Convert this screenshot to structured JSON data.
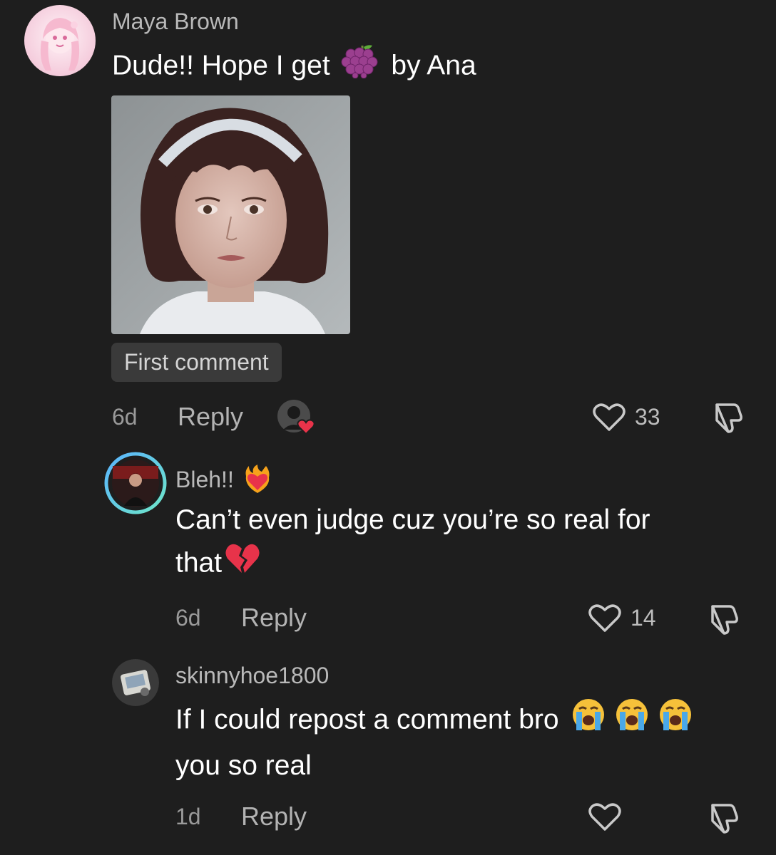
{
  "comments": [
    {
      "username": "Maya Brown",
      "text_before": "Dude!! Hope I get",
      "text_emoji": "grapes-emoji",
      "text_after": "by Ana",
      "tag": "First comment",
      "time": "6d",
      "reply_label": "Reply",
      "likes": "33",
      "liked_by_creator": true
    },
    {
      "username": "Bleh!!",
      "username_emoji": "heart-on-fire-emoji",
      "text_line1": "Can’t even judge cuz you’re so real for",
      "text_line2": "that",
      "text_emoji": "broken-heart-emoji",
      "time": "6d",
      "reply_label": "Reply",
      "likes": "14"
    },
    {
      "username": "skinnyhoe1800",
      "text_line1": "If I could repost a comment bro",
      "text_emojis": [
        "loudly-crying-emoji",
        "loudly-crying-emoji",
        "loudly-crying-emoji"
      ],
      "text_line2": "you so real",
      "time": "1d",
      "reply_label": "Reply",
      "likes": ""
    }
  ],
  "colors": {
    "background": "#1e1e1e",
    "username": "#b9b9b9",
    "text": "#ffffff",
    "meta": "#9a9a9a",
    "like_heart": "#e8334a",
    "story_ring_start": "#5ab4ff",
    "story_ring_end": "#6ee6c8"
  }
}
